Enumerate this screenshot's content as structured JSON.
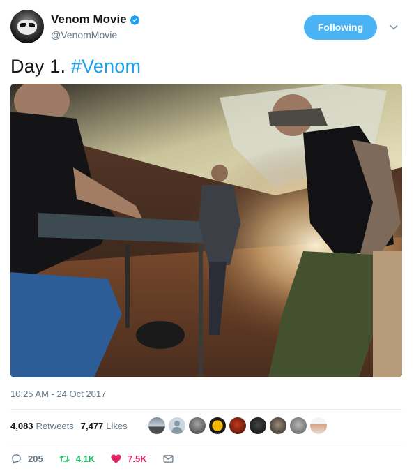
{
  "account": {
    "display_name": "Venom Movie",
    "handle": "@VenomMovie",
    "follow_button_label": "Following"
  },
  "tweet": {
    "text_plain": "Day 1. ",
    "hashtag": "#Venom",
    "timestamp": "10:25 AM - 24 Oct 2017"
  },
  "stats": {
    "retweets_count": "4,083",
    "retweets_label": "Retweets",
    "likes_count": "7,477",
    "likes_label": "Likes"
  },
  "actions": {
    "reply_count": "205",
    "retweet_count": "4.1K",
    "like_count": "7.5K"
  },
  "icons": {
    "verified": "verified-badge-icon",
    "caret": "chevron-down-icon",
    "reply": "reply-icon",
    "retweet": "retweet-icon",
    "like": "heart-icon",
    "message": "envelope-icon"
  },
  "colors": {
    "accent": "#1da1f2",
    "follow_button": "#4ab3f4",
    "retweet_green": "#17bf63",
    "like_red": "#e0245e",
    "muted_text": "#657786"
  }
}
